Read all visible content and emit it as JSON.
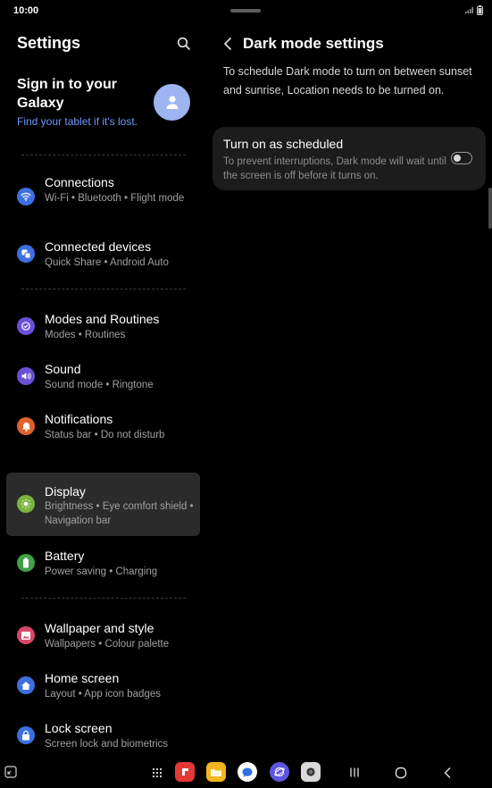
{
  "status_bar": {
    "time": "10:00"
  },
  "left_panel": {
    "title": "Settings",
    "signin": {
      "title": "Sign in to your Galaxy",
      "subtitle": "Find your tablet if it's lost."
    },
    "items": [
      {
        "label": "Connections",
        "sub": "Wi-Fi  •  Bluetooth  •  Flight mode",
        "icon": "wifi-icon",
        "color": "#3d6fe0"
      },
      {
        "label": "Connected devices",
        "sub": "Quick Share  •  Android Auto",
        "icon": "devices-icon",
        "color": "#3d6fe0"
      },
      {
        "label": "Modes and Routines",
        "sub": "Modes  •  Routines",
        "icon": "routines-icon",
        "color": "#6b4fd6"
      },
      {
        "label": "Sound",
        "sub": "Sound mode  •  Ringtone",
        "icon": "speaker-icon",
        "color": "#6b4fd6"
      },
      {
        "label": "Notifications",
        "sub": "Status bar  •  Do not disturb",
        "icon": "bell-icon",
        "color": "#e0622e"
      },
      {
        "label": "Display",
        "sub": "Brightness  •  Eye comfort shield  •  Navigation bar",
        "icon": "sun-icon",
        "color": "#7cb342"
      },
      {
        "label": "Battery",
        "sub": "Power saving  •  Charging",
        "icon": "battery-icon",
        "color": "#43a047"
      },
      {
        "label": "Wallpaper and style",
        "sub": "Wallpapers  •  Colour palette",
        "icon": "wallpaper-icon",
        "color": "#d9486b"
      },
      {
        "label": "Home screen",
        "sub": "Layout  •  App icon badges",
        "icon": "home-icon",
        "color": "#3d6fe0"
      },
      {
        "label": "Lock screen",
        "sub": "Screen lock and biometrics",
        "icon": "lock-icon",
        "color": "#3d6fe0"
      }
    ]
  },
  "right_panel": {
    "title": "Dark mode settings",
    "info": "To schedule Dark mode to turn on between sunset and sunrise, Location needs to be turned on.",
    "option": {
      "title": "Turn on as scheduled",
      "description": "To prevent interruptions, Dark mode will wait until the screen is off before it turns on.",
      "enabled": false
    }
  },
  "colors": {
    "accent": "#6f97ff",
    "background": "#000000",
    "card": "#1c1c1c",
    "selected": "#2b2b2b"
  }
}
